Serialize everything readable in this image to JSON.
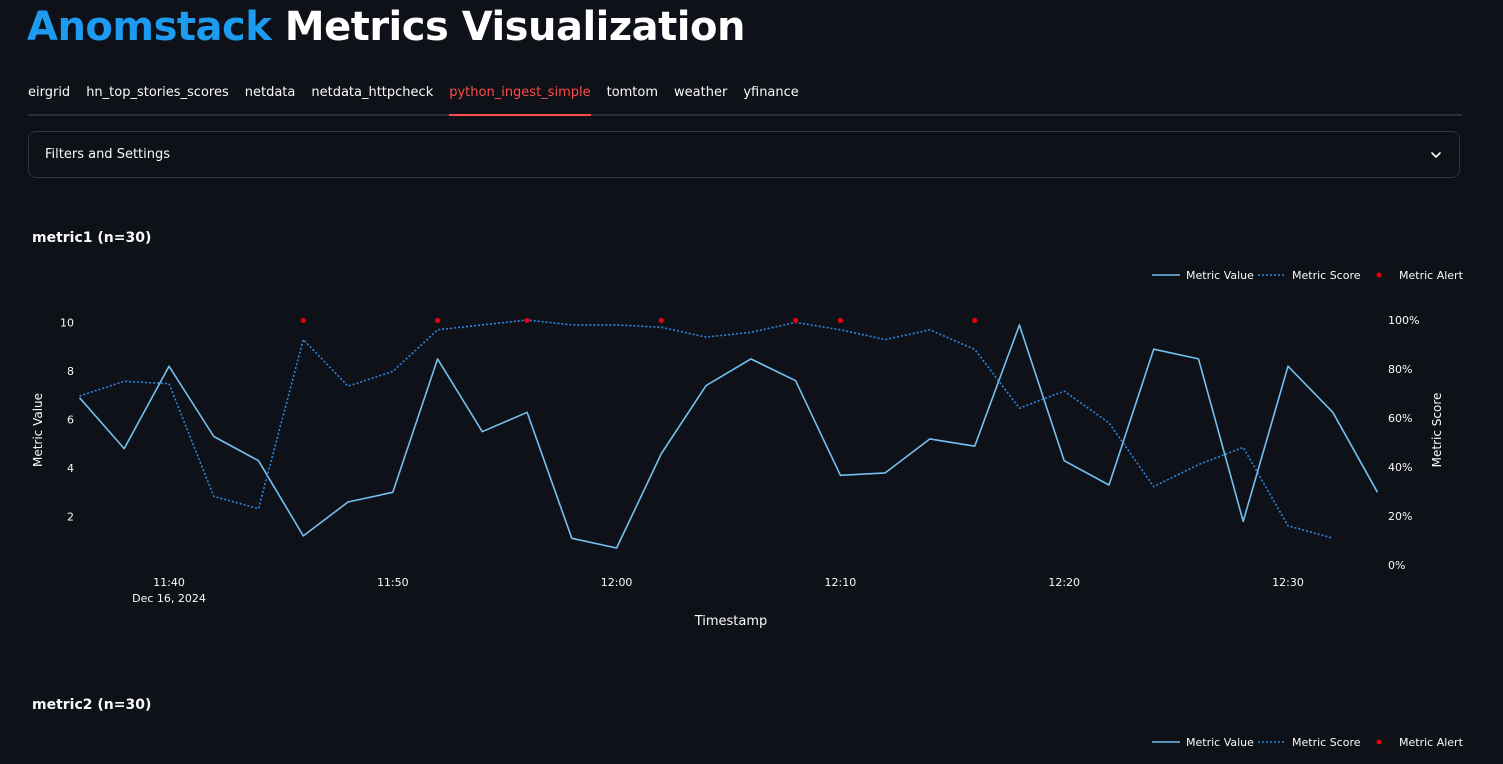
{
  "header": {
    "brand": "Anomstack",
    "rest": "Metrics Visualization"
  },
  "tabs": [
    {
      "label": "eirgrid",
      "active": false
    },
    {
      "label": "hn_top_stories_scores",
      "active": false
    },
    {
      "label": "netdata",
      "active": false
    },
    {
      "label": "netdata_httpcheck",
      "active": false
    },
    {
      "label": "python_ingest_simple",
      "active": true
    },
    {
      "label": "tomtom",
      "active": false
    },
    {
      "label": "weather",
      "active": false
    },
    {
      "label": "yfinance",
      "active": false
    }
  ],
  "expander": {
    "label": "Filters and Settings",
    "icon": "chevron-down-icon"
  },
  "metrics": [
    {
      "title": "metric1 (n=30)"
    },
    {
      "title": "metric2 (n=30)"
    }
  ],
  "legend": {
    "value": "Metric Value",
    "score": "Metric Score",
    "alert": "Metric Alert"
  },
  "colors": {
    "brand": "#1c9bf0",
    "active_tab": "#ff4b4b",
    "value_line": "#74c0f0",
    "score_line": "#2f86e0",
    "alert": "#e8000b"
  },
  "chart_data": [
    {
      "type": "line",
      "title": "metric1 (n=30)",
      "xlabel": "Timestamp",
      "ylabel": "Metric Value",
      "y2label": "Metric Score",
      "x_ticks": [
        "11:40",
        "11:50",
        "12:00",
        "12:10",
        "12:20",
        "12:30"
      ],
      "x_tick_date": "Dec 16, 2024",
      "y_ticks": [
        2,
        4,
        6,
        8,
        10
      ],
      "y2_ticks": [
        "0%",
        "20%",
        "40%",
        "60%",
        "80%",
        "100%"
      ],
      "ylim": [
        0,
        10.6
      ],
      "y2lim": [
        0,
        1
      ],
      "x": [
        "11:36",
        "11:38",
        "11:40",
        "11:42",
        "11:44",
        "11:46",
        "11:48",
        "11:50",
        "11:52",
        "11:54",
        "11:56",
        "11:58",
        "12:00",
        "12:02",
        "12:04",
        "12:06",
        "12:08",
        "12:10",
        "12:12",
        "12:14",
        "12:16",
        "12:18",
        "12:20",
        "12:22",
        "12:24",
        "12:26",
        "12:28",
        "12:30",
        "12:32",
        "12:34"
      ],
      "series": [
        {
          "name": "Metric Value",
          "values": [
            6.9,
            4.8,
            8.2,
            5.3,
            4.3,
            1.2,
            2.6,
            3.0,
            8.5,
            5.5,
            6.3,
            1.1,
            0.7,
            4.6,
            7.4,
            8.5,
            7.6,
            3.7,
            3.8,
            5.2,
            4.9,
            9.9,
            4.3,
            3.3,
            8.9,
            8.5,
            1.8,
            8.2,
            6.3,
            3.0
          ]
        },
        {
          "name": "Metric Score",
          "values": [
            0.69,
            0.75,
            0.74,
            0.28,
            0.23,
            0.92,
            0.73,
            0.79,
            0.96,
            0.98,
            1.0,
            0.98,
            0.98,
            0.97,
            0.93,
            0.95,
            0.99,
            0.96,
            0.92,
            0.96,
            0.88,
            0.64,
            0.71,
            0.58,
            0.32,
            0.41,
            0.48,
            0.16,
            0.11,
            null
          ]
        }
      ],
      "alerts": [
        {
          "x": "11:46",
          "score": 0.99
        },
        {
          "x": "11:52",
          "score": 0.99
        },
        {
          "x": "11:56",
          "score": 0.99
        },
        {
          "x": "12:02",
          "score": 0.99
        },
        {
          "x": "12:08",
          "score": 0.99
        },
        {
          "x": "12:10",
          "score": 0.99
        },
        {
          "x": "12:16",
          "score": 0.99
        }
      ]
    }
  ]
}
